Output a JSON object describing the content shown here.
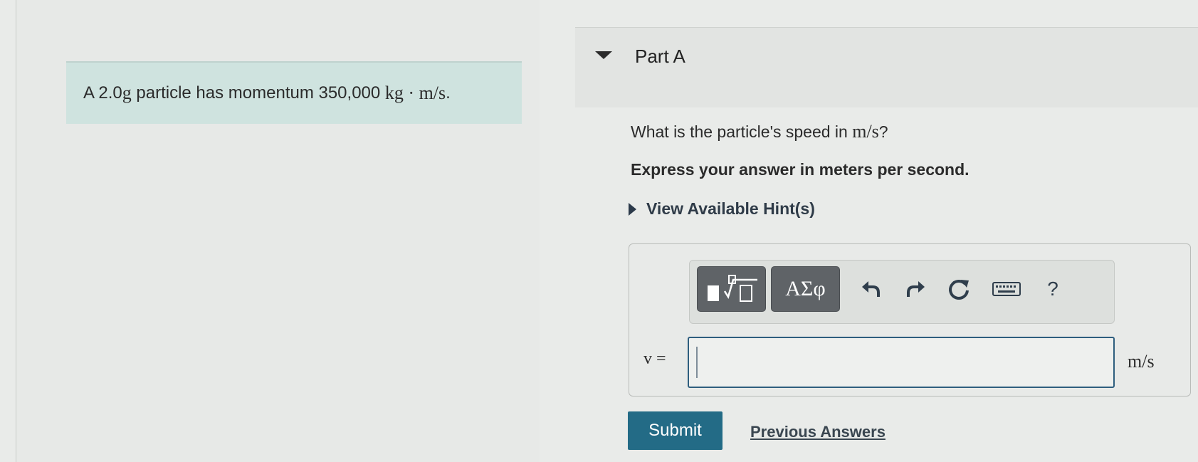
{
  "problem": {
    "text_prefix": "A 2.0 ",
    "mass_unit": "g",
    "text_middle": " particle has momentum 350,000 ",
    "momentum_unit": "kg · m/s",
    "text_suffix": "."
  },
  "part": {
    "title": "Part A",
    "question_prefix": "What is the particle's speed in ",
    "question_unit": "m/s",
    "question_suffix": "?",
    "instruction": "Express your answer in meters per second.",
    "hint_label": "View Available Hint(s)"
  },
  "toolbar": {
    "greek_label": "ΑΣφ",
    "help_label": "?",
    "icons": [
      "templates-icon",
      "undo-icon",
      "redo-icon",
      "reset-icon",
      "keyboard-icon",
      "help-icon"
    ]
  },
  "answer": {
    "variable_label": "v =",
    "value": "",
    "unit": "m/s"
  },
  "actions": {
    "submit_label": "Submit",
    "previous_answers_label": "Previous Answers"
  },
  "colors": {
    "problem_background": "#cfe3df",
    "submit_background": "#236b86",
    "input_border": "#2e5e7e"
  }
}
